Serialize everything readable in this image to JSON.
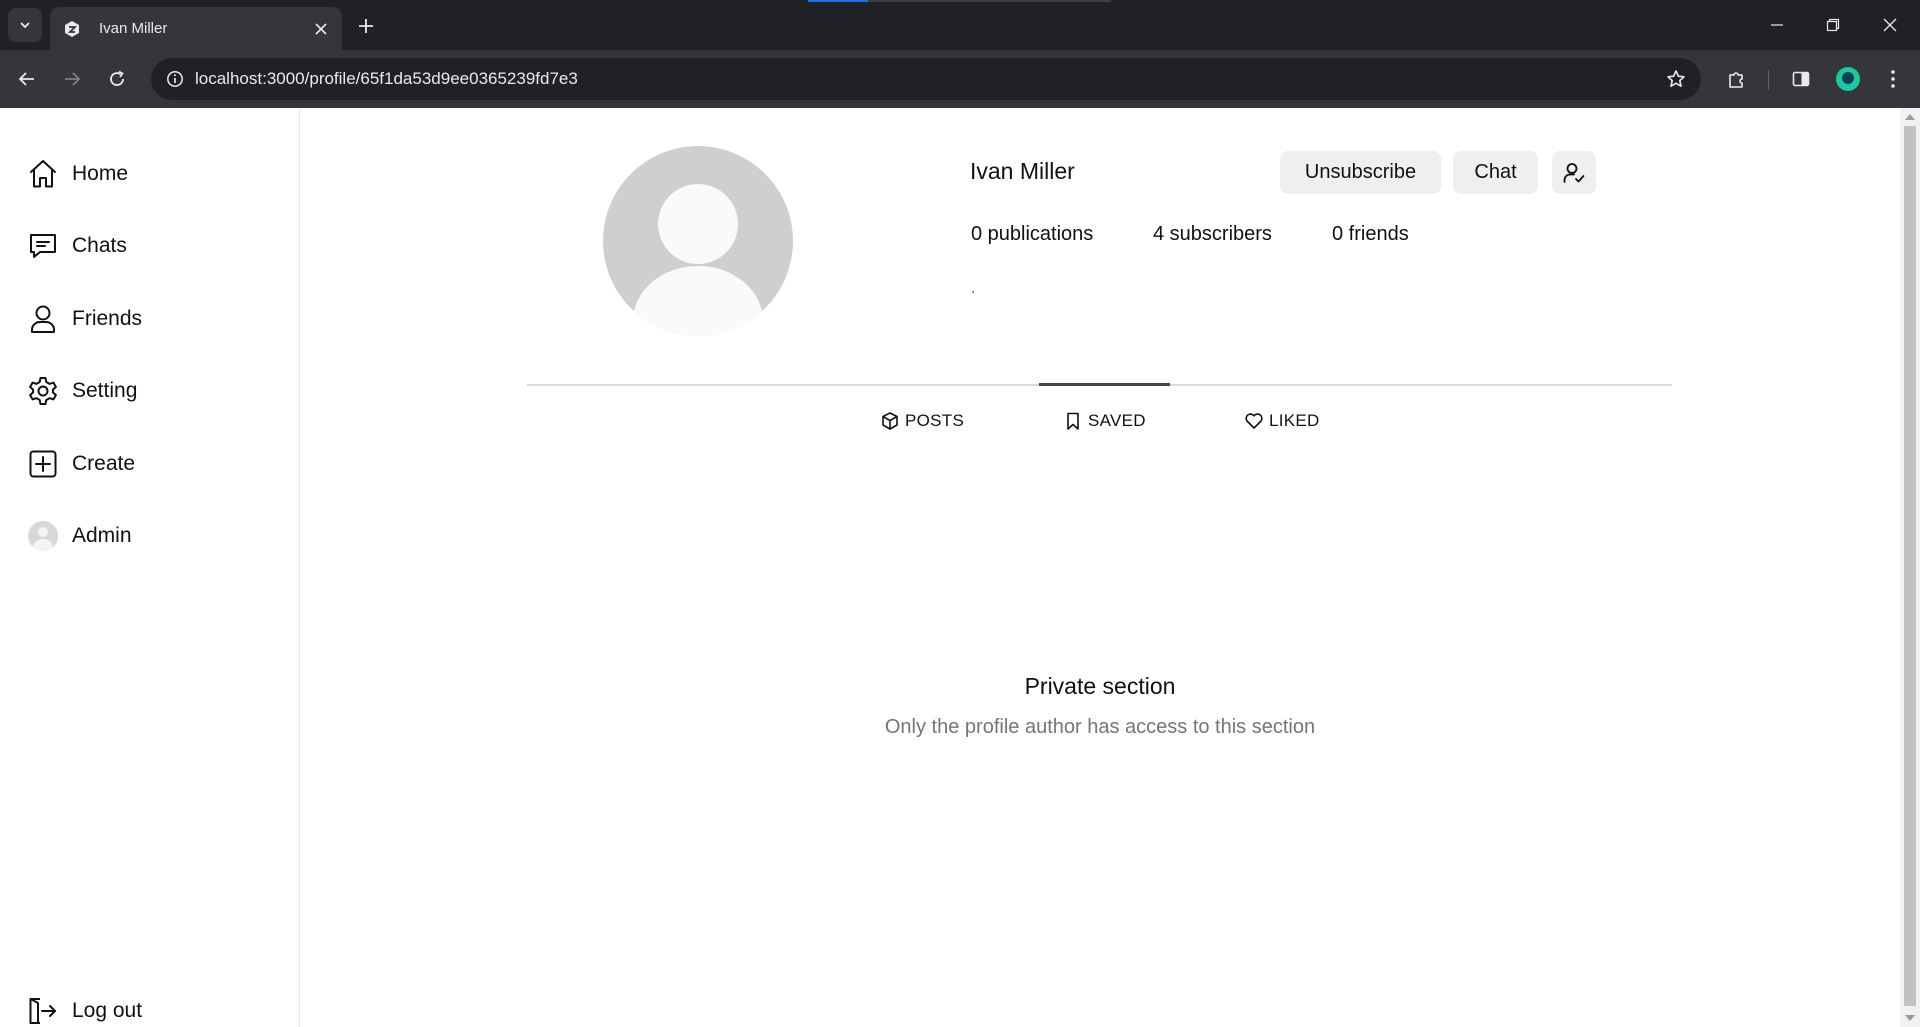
{
  "browser": {
    "tab_title": "Ivan Miller",
    "url": "localhost:3000/profile/65f1da53d9ee0365239fd7e3"
  },
  "sidebar": {
    "items": [
      {
        "label": "Home",
        "icon": "home-icon"
      },
      {
        "label": "Chats",
        "icon": "chat-icon"
      },
      {
        "label": "Friends",
        "icon": "user-icon"
      },
      {
        "label": "Setting",
        "icon": "gear-icon"
      },
      {
        "label": "Create",
        "icon": "plus-square-icon"
      },
      {
        "label": "Admin",
        "icon": "avatar"
      }
    ],
    "logout_label": "Log out"
  },
  "profile": {
    "name": "Ivan Miller",
    "unsubscribe_label": "Unsubscribe",
    "chat_label": "Chat",
    "publications": "0 publications",
    "subscribers": "4 subscribers",
    "friends": "0 friends",
    "bio": "."
  },
  "tabs": [
    {
      "label": "POSTS",
      "icon": "cube-icon"
    },
    {
      "label": "SAVED",
      "icon": "bookmark-icon",
      "active": true
    },
    {
      "label": "LIKED",
      "icon": "heart-icon"
    }
  ],
  "private_section": {
    "title": "Private section",
    "subtitle": "Only the profile author has access to this section"
  },
  "colors": {
    "chrome_dark": "#202124",
    "chrome_mid": "#35363a",
    "button_bg": "#efefef",
    "muted_text": "#757575",
    "profile_avatar": "#1ec7a4"
  }
}
